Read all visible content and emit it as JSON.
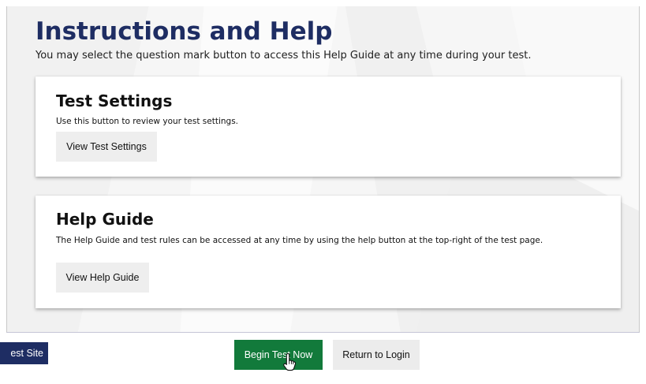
{
  "page": {
    "title": "Instructions and Help",
    "subtitle": "You may select the question mark button to access this Help Guide at any time during your test."
  },
  "test_settings": {
    "title": "Test Settings",
    "description": "Use this button to review your test settings.",
    "button_label": "View Test Settings"
  },
  "help_guide": {
    "title": "Help Guide",
    "description": "The Help Guide and test rules can be accessed at any time by using the help button at the top-right of the test page.",
    "button_label": "View Help Guide"
  },
  "footer": {
    "left_button_label": "est Site",
    "begin_button_label": "Begin Test Now",
    "return_button_label": "Return to Login"
  },
  "colors": {
    "title": "#1e2d63",
    "begin_button": "#127a3b",
    "left_button": "#1e2d63",
    "secondary_button": "#eeeeee"
  },
  "icons": {
    "cursor": "hand-pointer-icon"
  }
}
